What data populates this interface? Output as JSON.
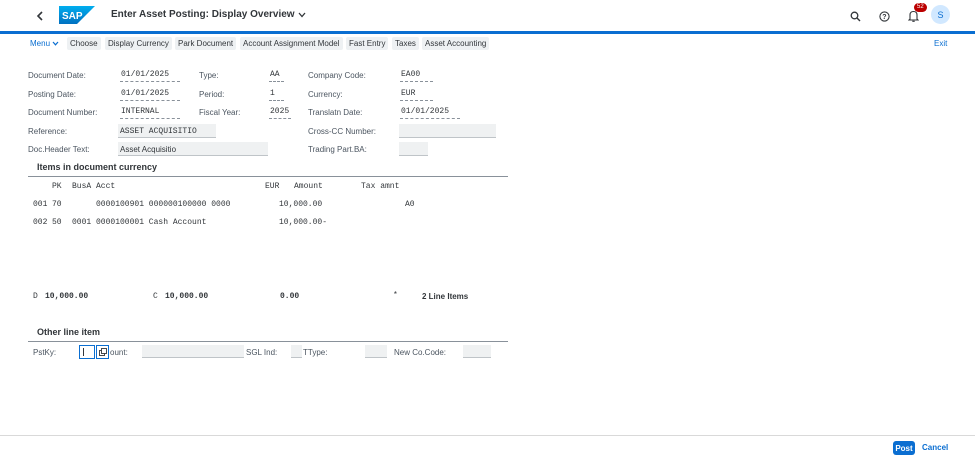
{
  "shell": {
    "title": "Enter Asset Posting: Display Overview",
    "notifications_count": "52",
    "avatar_initial": "S"
  },
  "toolbar": {
    "menu": "Menu",
    "buttons": [
      "Choose",
      "Display Currency",
      "Park Document",
      "Account Assignment Model",
      "Fast Entry",
      "Taxes",
      "Asset Accounting"
    ],
    "exit": "Exit"
  },
  "header": {
    "doc_date_label": "Document Date:",
    "doc_date": "01/01/2025",
    "type_label": "Type:",
    "type": "AA",
    "company_code_label": "Company Code:",
    "company_code": "EA00",
    "posting_date_label": "Posting Date:",
    "posting_date": "01/01/2025",
    "period_label": "Period:",
    "period": "1",
    "currency_label": "Currency:",
    "currency": "EUR",
    "doc_number_label": "Document Number:",
    "doc_number": "INTERNAL",
    "fiscal_year_label": "Fiscal Year:",
    "fiscal_year": "2025",
    "translatn_date_label": "Translatn Date:",
    "translatn_date": "01/01/2025",
    "reference_label": "Reference:",
    "reference": "ASSET ACQUISITIO",
    "cross_cc_label": "Cross-CC Number:",
    "cross_cc": "",
    "doc_header_text_label": "Doc.Header Text:",
    "doc_header_text": "Asset Acquisitio",
    "trading_part_label": "Trading Part.BA:",
    "trading_part": ""
  },
  "items": {
    "title": "Items in document currency",
    "col_pk": "PK",
    "col_busa": "BusA",
    "col_acct": "Acct",
    "col_cur": "EUR",
    "col_amount": "Amount",
    "col_tax": "Tax amnt",
    "rows": [
      {
        "no": "001",
        "pk": "70",
        "busa": "",
        "acct": "0000100901 000000100000 0000",
        "amount": "10,000.00",
        "tax": "A0"
      },
      {
        "no": "002",
        "pk": "50",
        "busa": "0001",
        "acct": "0000100001 Cash Account",
        "amount": "10,000.00-",
        "tax": ""
      }
    ],
    "totals": {
      "d_label": "D",
      "d_value": "10,000.00",
      "c_label": "C",
      "c_value": "10,000.00",
      "balance": "0.00",
      "star": "*",
      "line_items": "2 Line Items"
    }
  },
  "other": {
    "title": "Other line item",
    "pstky_label": "PstKy:",
    "account_label": "ount:",
    "sgl_label": "SGL Ind:",
    "ttype_label": "TType:",
    "new_co_label": "New Co.Code:"
  },
  "footer": {
    "post": "Post",
    "cancel": "Cancel"
  },
  "colors": {
    "accent": "#0a6ed1",
    "badge": "#bb0000"
  }
}
